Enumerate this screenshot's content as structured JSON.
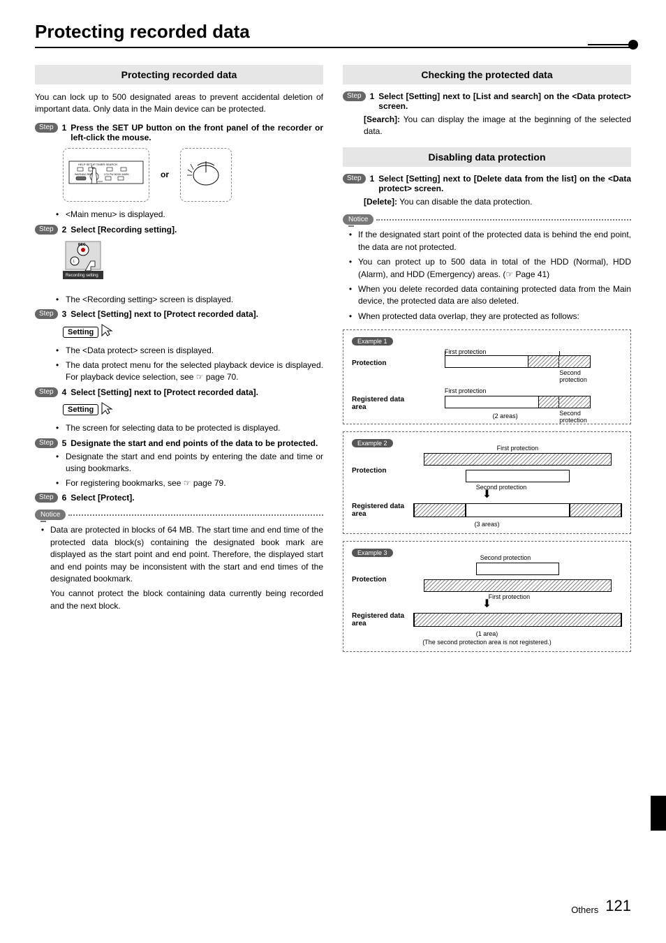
{
  "page_title": "Protecting recorded data",
  "or_label": "or",
  "setting_button_label": "Setting",
  "footer": {
    "category": "Others",
    "page_number": "121"
  },
  "left": {
    "section1_title": "Protecting recorded data",
    "intro": "You can lock up to 500 designated areas to prevent accidental deletion of important data. Only data in the Main device can be protected.",
    "step1": "Press the SET UP button on the front panel of the recorder or left-click the mouse.",
    "step1_sub": "<Main menu> is displayed.",
    "step2": "Select [Recording setting].",
    "rec_icon_caption": "Recording setting",
    "step2_sub": "The <Recording setting> screen is displayed.",
    "step3": "Select [Setting] next to [Protect recorded data].",
    "step3_sub1": "The <Data protect> screen is displayed.",
    "step3_sub2": "The data protect menu for the selected playback device is displayed. For playback device selection, see ☞ page 70.",
    "step4": "Select [Setting] next to [Protect recorded data].",
    "step4_sub": "The screen for selecting data to be protected is displayed.",
    "step5": "Designate the start and end points of the data to be protected.",
    "step5_sub1": "Designate the start and end points by entering the date and time or using bookmarks.",
    "step5_sub2": "For registering bookmarks, see ☞ page 79.",
    "step6": "Select [Protect].",
    "notice_label": "Notice",
    "notice_b1": "Data are protected in blocks of 64 MB. The start time and end time of the protected data block(s) containing the designated book mark are displayed as the start point and end point. Therefore, the displayed start and end points may be inconsistent with the start and end times of the designated bookmark.",
    "notice_b2": "You cannot protect the block containing data currently being recorded and the next block."
  },
  "right": {
    "section1_title": "Checking the protected data",
    "step1": "Select [Setting] next to [List and search] on the <Data protect> screen.",
    "step1_search_label": "[Search]:",
    "step1_search_desc": " You can display the image at the beginning of the selected data.",
    "section2_title": "Disabling data protection",
    "d_step1": "Select [Setting] next to [Delete data from the list] on the <Data protect> screen.",
    "d_step1_delete_label": "[Delete]:",
    "d_step1_delete_desc": " You can disable the data protection.",
    "notice_label": "Notice",
    "n1": "If the designated start point of the protected data is behind the end point, the data are not protected.",
    "n2": "You can protect up to 500 data in total of the HDD (Normal), HDD (Alarm), and HDD (Emergency) areas. (☞ Page 41)",
    "n3": "When you delete recorded data containing protected data from the Main device, the protected data are also deleted.",
    "n4": "When protected data overlap, they are protected as follows:",
    "examples": {
      "ex1_label": "Example 1",
      "ex2_label": "Example 2",
      "ex3_label": "Example 3",
      "protection_row": "Protection",
      "registered_row": "Registered data area",
      "first_protection": "First protection",
      "second_protection": "Second protection",
      "areas2": "(2 areas)",
      "areas3": "(3 areas)",
      "area1": "(1 area)",
      "note_ex3": "(The second protection area is not registered.)"
    }
  }
}
